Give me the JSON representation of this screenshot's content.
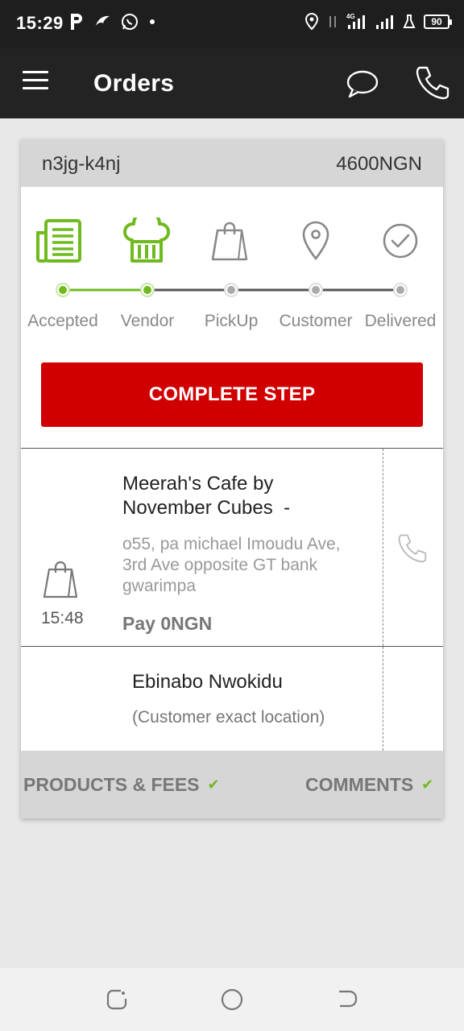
{
  "status_bar": {
    "time": "15:29",
    "network": "4G",
    "battery": "90",
    "icons": [
      "parking-icon",
      "bird-icon",
      "whatsapp-icon",
      "dot-icon",
      "location-icon",
      "data-arrows-icon",
      "signal-icon",
      "signal-icon",
      "lab-icon"
    ]
  },
  "app_bar": {
    "title": "Orders",
    "icons": [
      "menu-icon",
      "chat-icon",
      "phone-icon"
    ]
  },
  "order": {
    "id": "n3jg-k4nj",
    "amount": "4600NGN"
  },
  "steps": [
    {
      "label": "Accepted",
      "icon": "clipboard-icon",
      "active": true
    },
    {
      "label": "Vendor",
      "icon": "chef-hat-icon",
      "active": true
    },
    {
      "label": "PickUp",
      "icon": "shopping-bag-icon",
      "active": false
    },
    {
      "label": "Customer",
      "icon": "location-pin-icon",
      "active": false
    },
    {
      "label": "Delivered",
      "icon": "check-circle-icon",
      "active": false
    }
  ],
  "complete_button": "COMPLETE STEP",
  "pickup": {
    "time": "15:48",
    "vendor_line1": "Meerah's Cafe by",
    "vendor_line2": "November Cubes  -",
    "address": "o55, pa michael Imoudu Ave, 3rd Ave opposite GT bank gwarimpa",
    "pay": "Pay 0NGN"
  },
  "customer": {
    "name": "Ebinabo Nwokidu",
    "location": "(Customer exact location)"
  },
  "footer": {
    "products": "PRODUCTS & FEES",
    "comments": "COMMENTS",
    "check": "✔"
  },
  "colors": {
    "accent_green": "#6fba1e",
    "button_red": "#d10000",
    "app_bar": "#232323"
  }
}
